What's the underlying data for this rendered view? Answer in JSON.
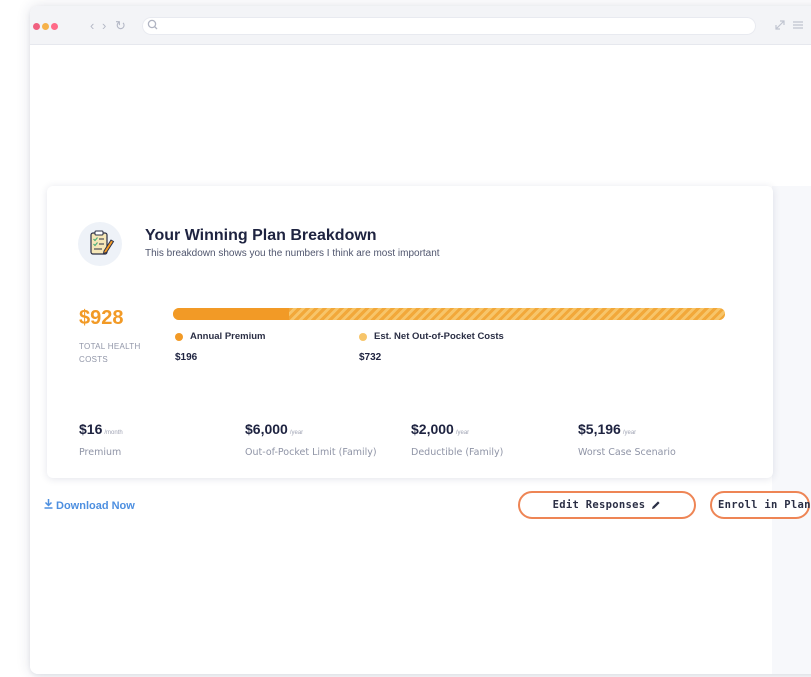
{
  "browser": {
    "nav_back": "‹",
    "nav_forward": "›",
    "nav_refresh": "↻",
    "right_icons": [
      "expand-icon",
      "menu-icon"
    ]
  },
  "card": {
    "title": "Your Winning Plan Breakdown",
    "subtitle": "This breakdown shows you the numbers I think are most important",
    "icon": "clipboard-pencil-icon"
  },
  "total": {
    "amount": "$928",
    "label": "TOTAL HEALTH COSTS"
  },
  "breakdown": {
    "premium_fraction": 0.211,
    "segments": [
      {
        "label": "Annual Premium",
        "value": "$196",
        "color": "#f29a26"
      },
      {
        "label": "Est. Net Out-of-Pocket Costs",
        "value": "$732",
        "color": "#f7c56a"
      }
    ]
  },
  "stats": [
    {
      "amount": "$16",
      "unit": "/month",
      "label": "Premium"
    },
    {
      "amount": "$6,000",
      "unit": "/year",
      "label": "Out-of-Pocket Limit (Family)"
    },
    {
      "amount": "$2,000",
      "unit": "/year",
      "label": "Deductible (Family)"
    },
    {
      "amount": "$5,196",
      "unit": "/year",
      "label": "Worst Case Scenario"
    }
  ],
  "actions": {
    "download": "Download Now",
    "edit": "Edit Responses",
    "enroll": "Enroll in Plan"
  },
  "colors": {
    "accent_orange": "#f29a26",
    "accent_light": "#f7c56a",
    "button_border": "#ee8555",
    "link_blue": "#4d8fe0"
  }
}
